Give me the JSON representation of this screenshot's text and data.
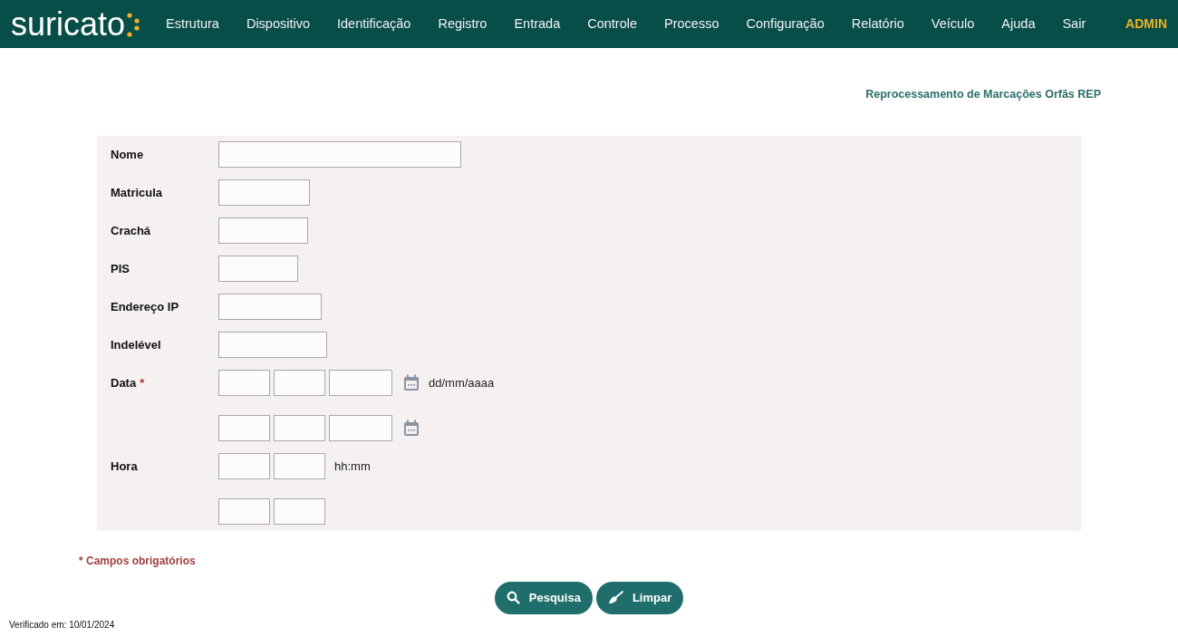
{
  "brand": "suricato",
  "nav": [
    {
      "label": "Estrutura"
    },
    {
      "label": "Dispositivo"
    },
    {
      "label": "Identificação"
    },
    {
      "label": "Registro"
    },
    {
      "label": "Entrada"
    },
    {
      "label": "Controle"
    },
    {
      "label": "Processo"
    },
    {
      "label": "Configuração"
    },
    {
      "label": "Relatório"
    },
    {
      "label": "Veículo"
    },
    {
      "label": "Ajuda"
    },
    {
      "label": "Sair"
    }
  ],
  "user": "ADMIN",
  "page_title": "Reprocessamento de Marcações Orfãs REP",
  "form": [
    {
      "kind": "text",
      "label": "Nome"
    },
    {
      "kind": "text",
      "label": "Matricula"
    },
    {
      "kind": "text",
      "label": "Crachá"
    },
    {
      "kind": "text",
      "label": "PIS"
    },
    {
      "kind": "text",
      "label": "Endereço IP"
    },
    {
      "kind": "text",
      "label": "Indelével"
    },
    {
      "kind": "date",
      "label": "Data",
      "required_mark": "*",
      "hint": "dd/mm/aaaa"
    },
    {
      "kind": "date"
    },
    {
      "kind": "time",
      "label": "Hora",
      "hint": "hh:mm"
    },
    {
      "kind": "time"
    }
  ],
  "required_note": "* Campos obrigatórios",
  "buttons": [
    {
      "kind": "search",
      "label": "Pesquisa"
    },
    {
      "kind": "clear",
      "label": "Limpar"
    }
  ],
  "footer": "Verificado em: 10/01/2024"
}
